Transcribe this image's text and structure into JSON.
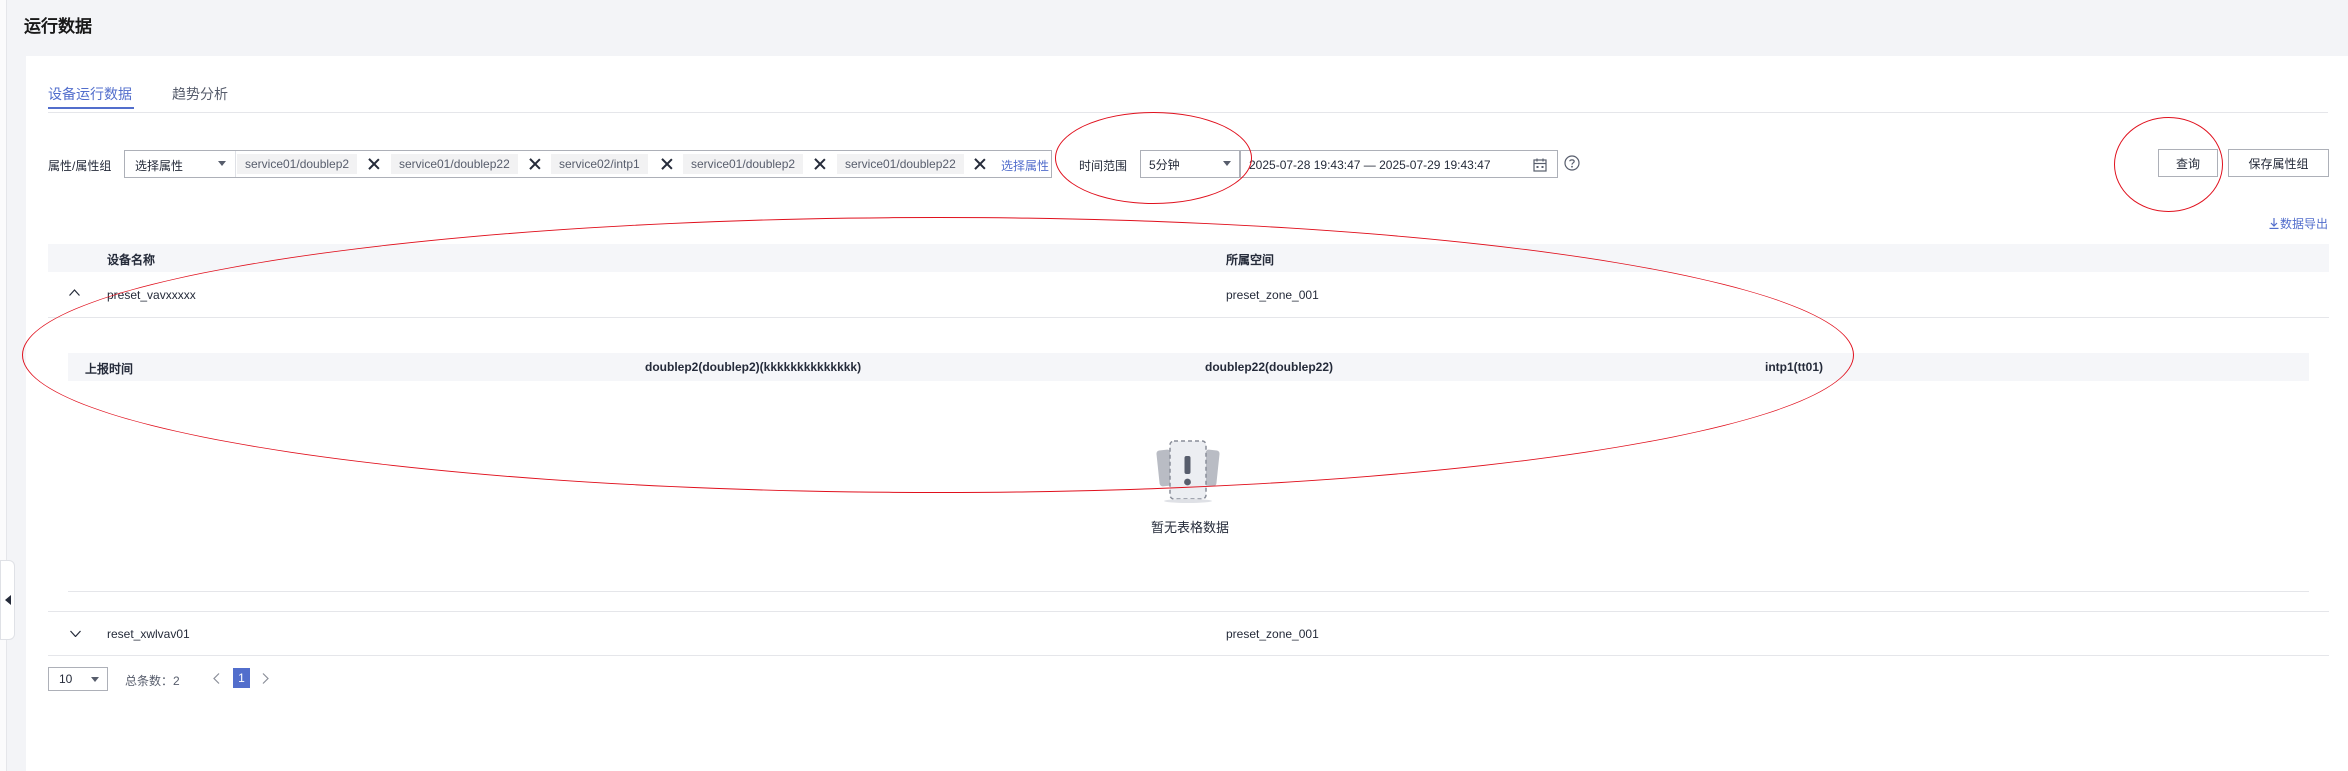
{
  "page": {
    "title": "运行数据"
  },
  "tabs": [
    {
      "label": "设备运行数据",
      "active": true
    },
    {
      "label": "趋势分析",
      "active": false
    }
  ],
  "filter": {
    "attr_label": "属性/属性组",
    "attr_select_placeholder": "选择属性",
    "chips": [
      "service01/doublep2",
      "service01/doublep22",
      "service02/intp1",
      "service01/doublep2",
      "service01/doublep22"
    ],
    "select_attr_link": "选择属性",
    "time_range_label": "时间范围",
    "time_range_value": "5分钟",
    "date_range": "2025-07-28 19:43:47 — 2025-07-29 19:43:47"
  },
  "actions": {
    "query": "查询",
    "save_group": "保存属性组",
    "export": "数据导出"
  },
  "table": {
    "columns": [
      "设备名称",
      "所属空间"
    ],
    "rows": [
      {
        "device": "preset_vavxxxxx",
        "space": "preset_zone_001",
        "expanded": true
      },
      {
        "device": "reset_xwlvav01",
        "space": "preset_zone_001",
        "expanded": false
      }
    ],
    "inner_columns": [
      "上报时间",
      "doublep2(doublep2)(kkkkkkkkkkkkkk)",
      "doublep22(doublep22)",
      "intp1(tt01)"
    ],
    "empty_text": "暂无表格数据"
  },
  "pagination": {
    "page_size": "10",
    "total_label": "总条数：2",
    "current_page": "1"
  },
  "colors": {
    "accent": "#526ecc",
    "annotation": "#e0101d"
  }
}
